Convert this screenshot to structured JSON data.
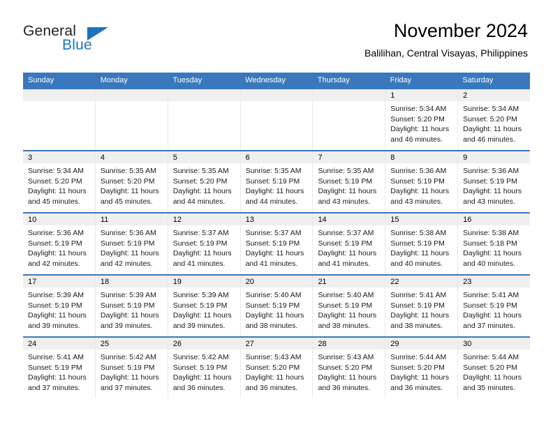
{
  "brand": {
    "name_part1": "General",
    "name_part2": "Blue"
  },
  "header": {
    "title": "November 2024",
    "subtitle": "Balilihan, Central Visayas, Philippines"
  },
  "colors": {
    "header_blue": "#3a78bd",
    "brand_blue": "#1c75bc",
    "day_band_gray": "#efefef"
  },
  "weekdays": [
    "Sunday",
    "Monday",
    "Tuesday",
    "Wednesday",
    "Thursday",
    "Friday",
    "Saturday"
  ],
  "weeks": [
    [
      {
        "day": "",
        "sunrise": "",
        "sunset": "",
        "daylight": ""
      },
      {
        "day": "",
        "sunrise": "",
        "sunset": "",
        "daylight": ""
      },
      {
        "day": "",
        "sunrise": "",
        "sunset": "",
        "daylight": ""
      },
      {
        "day": "",
        "sunrise": "",
        "sunset": "",
        "daylight": ""
      },
      {
        "day": "",
        "sunrise": "",
        "sunset": "",
        "daylight": ""
      },
      {
        "day": "1",
        "sunrise": "Sunrise: 5:34 AM",
        "sunset": "Sunset: 5:20 PM",
        "daylight": "Daylight: 11 hours and 46 minutes."
      },
      {
        "day": "2",
        "sunrise": "Sunrise: 5:34 AM",
        "sunset": "Sunset: 5:20 PM",
        "daylight": "Daylight: 11 hours and 46 minutes."
      }
    ],
    [
      {
        "day": "3",
        "sunrise": "Sunrise: 5:34 AM",
        "sunset": "Sunset: 5:20 PM",
        "daylight": "Daylight: 11 hours and 45 minutes."
      },
      {
        "day": "4",
        "sunrise": "Sunrise: 5:35 AM",
        "sunset": "Sunset: 5:20 PM",
        "daylight": "Daylight: 11 hours and 45 minutes."
      },
      {
        "day": "5",
        "sunrise": "Sunrise: 5:35 AM",
        "sunset": "Sunset: 5:20 PM",
        "daylight": "Daylight: 11 hours and 44 minutes."
      },
      {
        "day": "6",
        "sunrise": "Sunrise: 5:35 AM",
        "sunset": "Sunset: 5:19 PM",
        "daylight": "Daylight: 11 hours and 44 minutes."
      },
      {
        "day": "7",
        "sunrise": "Sunrise: 5:35 AM",
        "sunset": "Sunset: 5:19 PM",
        "daylight": "Daylight: 11 hours and 43 minutes."
      },
      {
        "day": "8",
        "sunrise": "Sunrise: 5:36 AM",
        "sunset": "Sunset: 5:19 PM",
        "daylight": "Daylight: 11 hours and 43 minutes."
      },
      {
        "day": "9",
        "sunrise": "Sunrise: 5:36 AM",
        "sunset": "Sunset: 5:19 PM",
        "daylight": "Daylight: 11 hours and 43 minutes."
      }
    ],
    [
      {
        "day": "10",
        "sunrise": "Sunrise: 5:36 AM",
        "sunset": "Sunset: 5:19 PM",
        "daylight": "Daylight: 11 hours and 42 minutes."
      },
      {
        "day": "11",
        "sunrise": "Sunrise: 5:36 AM",
        "sunset": "Sunset: 5:19 PM",
        "daylight": "Daylight: 11 hours and 42 minutes."
      },
      {
        "day": "12",
        "sunrise": "Sunrise: 5:37 AM",
        "sunset": "Sunset: 5:19 PM",
        "daylight": "Daylight: 11 hours and 41 minutes."
      },
      {
        "day": "13",
        "sunrise": "Sunrise: 5:37 AM",
        "sunset": "Sunset: 5:19 PM",
        "daylight": "Daylight: 11 hours and 41 minutes."
      },
      {
        "day": "14",
        "sunrise": "Sunrise: 5:37 AM",
        "sunset": "Sunset: 5:19 PM",
        "daylight": "Daylight: 11 hours and 41 minutes."
      },
      {
        "day": "15",
        "sunrise": "Sunrise: 5:38 AM",
        "sunset": "Sunset: 5:19 PM",
        "daylight": "Daylight: 11 hours and 40 minutes."
      },
      {
        "day": "16",
        "sunrise": "Sunrise: 5:38 AM",
        "sunset": "Sunset: 5:18 PM",
        "daylight": "Daylight: 11 hours and 40 minutes."
      }
    ],
    [
      {
        "day": "17",
        "sunrise": "Sunrise: 5:39 AM",
        "sunset": "Sunset: 5:19 PM",
        "daylight": "Daylight: 11 hours and 39 minutes."
      },
      {
        "day": "18",
        "sunrise": "Sunrise: 5:39 AM",
        "sunset": "Sunset: 5:19 PM",
        "daylight": "Daylight: 11 hours and 39 minutes."
      },
      {
        "day": "19",
        "sunrise": "Sunrise: 5:39 AM",
        "sunset": "Sunset: 5:19 PM",
        "daylight": "Daylight: 11 hours and 39 minutes."
      },
      {
        "day": "20",
        "sunrise": "Sunrise: 5:40 AM",
        "sunset": "Sunset: 5:19 PM",
        "daylight": "Daylight: 11 hours and 38 minutes."
      },
      {
        "day": "21",
        "sunrise": "Sunrise: 5:40 AM",
        "sunset": "Sunset: 5:19 PM",
        "daylight": "Daylight: 11 hours and 38 minutes."
      },
      {
        "day": "22",
        "sunrise": "Sunrise: 5:41 AM",
        "sunset": "Sunset: 5:19 PM",
        "daylight": "Daylight: 11 hours and 38 minutes."
      },
      {
        "day": "23",
        "sunrise": "Sunrise: 5:41 AM",
        "sunset": "Sunset: 5:19 PM",
        "daylight": "Daylight: 11 hours and 37 minutes."
      }
    ],
    [
      {
        "day": "24",
        "sunrise": "Sunrise: 5:41 AM",
        "sunset": "Sunset: 5:19 PM",
        "daylight": "Daylight: 11 hours and 37 minutes."
      },
      {
        "day": "25",
        "sunrise": "Sunrise: 5:42 AM",
        "sunset": "Sunset: 5:19 PM",
        "daylight": "Daylight: 11 hours and 37 minutes."
      },
      {
        "day": "26",
        "sunrise": "Sunrise: 5:42 AM",
        "sunset": "Sunset: 5:19 PM",
        "daylight": "Daylight: 11 hours and 36 minutes."
      },
      {
        "day": "27",
        "sunrise": "Sunrise: 5:43 AM",
        "sunset": "Sunset: 5:20 PM",
        "daylight": "Daylight: 11 hours and 36 minutes."
      },
      {
        "day": "28",
        "sunrise": "Sunrise: 5:43 AM",
        "sunset": "Sunset: 5:20 PM",
        "daylight": "Daylight: 11 hours and 36 minutes."
      },
      {
        "day": "29",
        "sunrise": "Sunrise: 5:44 AM",
        "sunset": "Sunset: 5:20 PM",
        "daylight": "Daylight: 11 hours and 36 minutes."
      },
      {
        "day": "30",
        "sunrise": "Sunrise: 5:44 AM",
        "sunset": "Sunset: 5:20 PM",
        "daylight": "Daylight: 11 hours and 35 minutes."
      }
    ]
  ]
}
